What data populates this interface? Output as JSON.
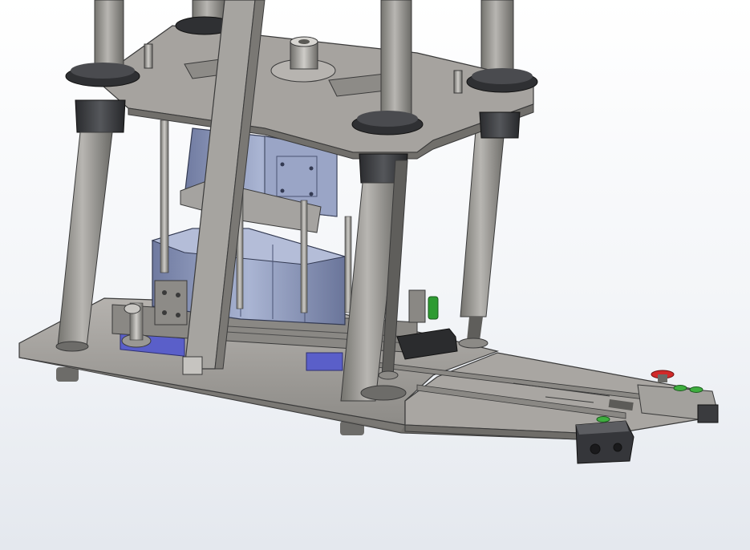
{
  "viewport": {
    "background_top": "#ffffff",
    "background_bottom": "#e4e8ee"
  },
  "model": {
    "colors": {
      "frame_grey": "#a7a4a0",
      "column_grey": "#9c9b98",
      "dark_sleeve": "#3b3d40",
      "blue_part": "#5a5fc9",
      "cylinder_blue": "#8f9bbd",
      "button_red": "#d12a2a",
      "button_green": "#3fae3f"
    }
  }
}
